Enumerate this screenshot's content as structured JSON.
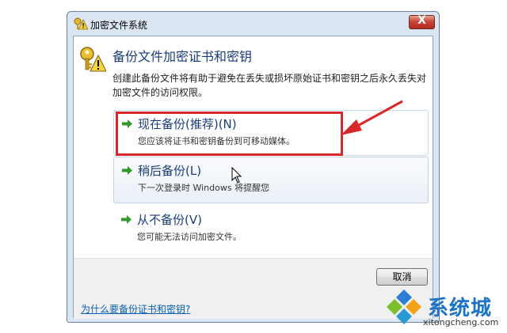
{
  "window": {
    "title": "加密文件系统",
    "close_label": "X"
  },
  "content": {
    "heading": "备份文件加密证书和密钥",
    "description": "创建此备份文件将有助于避免在丢失或损坏原始证书和密钥之后永久丢失对加密文件的访问权限。"
  },
  "options": [
    {
      "title": "现在备份(推荐)(N)",
      "subtitle": "您应该将证书和密钥备份到可移动媒体。"
    },
    {
      "title": "稍后备份(L)",
      "subtitle": "下一次登录时 Windows 将提醒您"
    },
    {
      "title": "从不备份(V)",
      "subtitle": "您可能无法访问加密文件。"
    }
  ],
  "footer": {
    "cancel_label": "取消",
    "help_link": "为什么要备份证书和密钥?"
  },
  "watermark": {
    "brand": "系统城",
    "url": "xitongcheng.com"
  },
  "colors": {
    "accent_blue": "#1a3c7a",
    "highlight_red": "#d9262b",
    "arrow_green": "#2e9a2a",
    "link_blue": "#0b5fb4"
  },
  "icons": [
    "key-warning-icon",
    "green-arrow-icon",
    "close-icon",
    "mouse-cursor-icon",
    "watermark-logo-icon"
  ]
}
